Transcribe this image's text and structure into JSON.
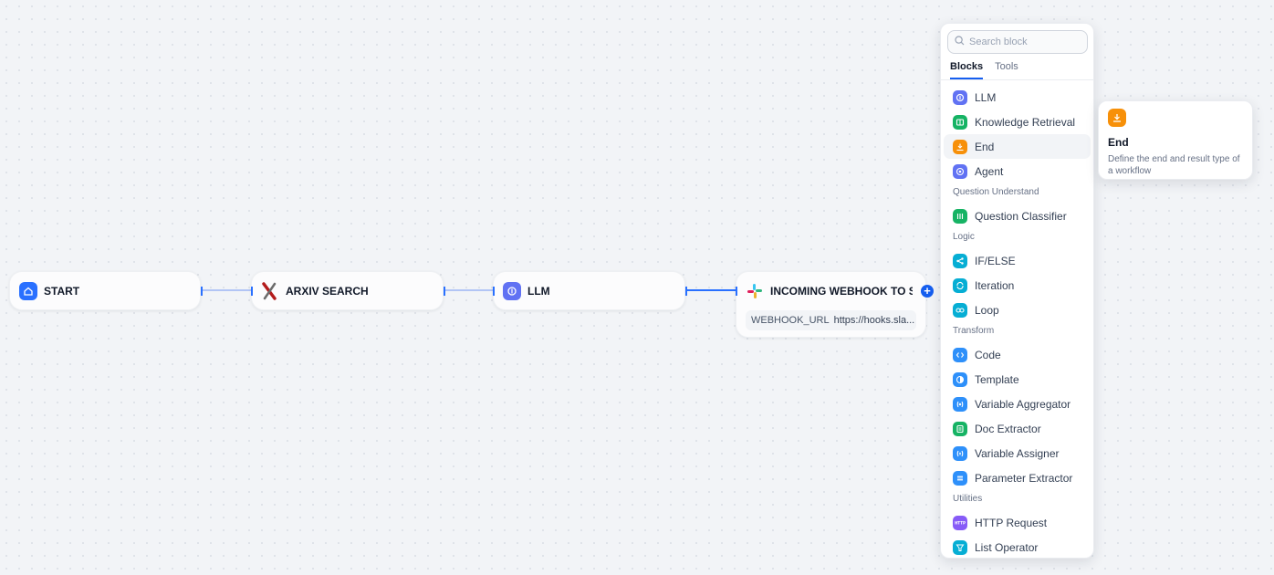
{
  "canvas": {
    "nodes": {
      "start": {
        "title": "START",
        "icon": "home-icon",
        "color": "#2970ff"
      },
      "arxiv": {
        "title": "ARXIV SEARCH",
        "icon": "arxiv-logo-icon",
        "color": "#b31b1b"
      },
      "llm": {
        "title": "LLM",
        "icon": "llm-icon",
        "color": "#6172f3"
      },
      "webhook": {
        "title": "INCOMING WEBHOOK TO SE",
        "icon": "slack-logo-icon",
        "param_key": "WEBHOOK_URL",
        "param_value": "https://hooks.sla..."
      }
    }
  },
  "block_picker": {
    "search_placeholder": "Search block",
    "tabs": [
      "Blocks",
      "Tools"
    ],
    "active_tab": "Blocks",
    "groups": [
      {
        "title": "",
        "items": [
          {
            "label": "LLM",
            "icon": "llm-icon",
            "color": "#6172f3"
          },
          {
            "label": "Knowledge Retrieval",
            "icon": "book-icon",
            "color": "#16b364"
          },
          {
            "label": "End",
            "icon": "end-icon",
            "color": "#f79009",
            "hover": true
          },
          {
            "label": "Agent",
            "icon": "agent-icon",
            "color": "#6172f3"
          }
        ]
      },
      {
        "title": "Question Understand",
        "items": [
          {
            "label": "Question Classifier",
            "icon": "classifier-icon",
            "color": "#16b364"
          }
        ]
      },
      {
        "title": "Logic",
        "items": [
          {
            "label": "IF/ELSE",
            "icon": "branch-icon",
            "color": "#06aed4"
          },
          {
            "label": "Iteration",
            "icon": "iteration-icon",
            "color": "#06aed4"
          },
          {
            "label": "Loop",
            "icon": "loop-icon",
            "color": "#06aed4"
          }
        ]
      },
      {
        "title": "Transform",
        "items": [
          {
            "label": "Code",
            "icon": "code-icon",
            "color": "#2e90fa"
          },
          {
            "label": "Template",
            "icon": "template-icon",
            "color": "#2e90fa"
          },
          {
            "label": "Variable Aggregator",
            "icon": "variable-icon",
            "color": "#2e90fa"
          },
          {
            "label": "Doc Extractor",
            "icon": "doc-icon",
            "color": "#16b364"
          },
          {
            "label": "Variable Assigner",
            "icon": "assigner-icon",
            "color": "#2e90fa"
          },
          {
            "label": "Parameter Extractor",
            "icon": "parameter-icon",
            "color": "#2e90fa"
          }
        ]
      },
      {
        "title": "Utilities",
        "items": [
          {
            "label": "HTTP Request",
            "icon": "http-icon",
            "color": "#875bf7"
          },
          {
            "label": "List Operator",
            "icon": "filter-icon",
            "color": "#06aed4"
          }
        ]
      }
    ]
  },
  "tooltip": {
    "icon": "end-icon",
    "title": "End",
    "description": "Define the end and result type of a workflow"
  }
}
